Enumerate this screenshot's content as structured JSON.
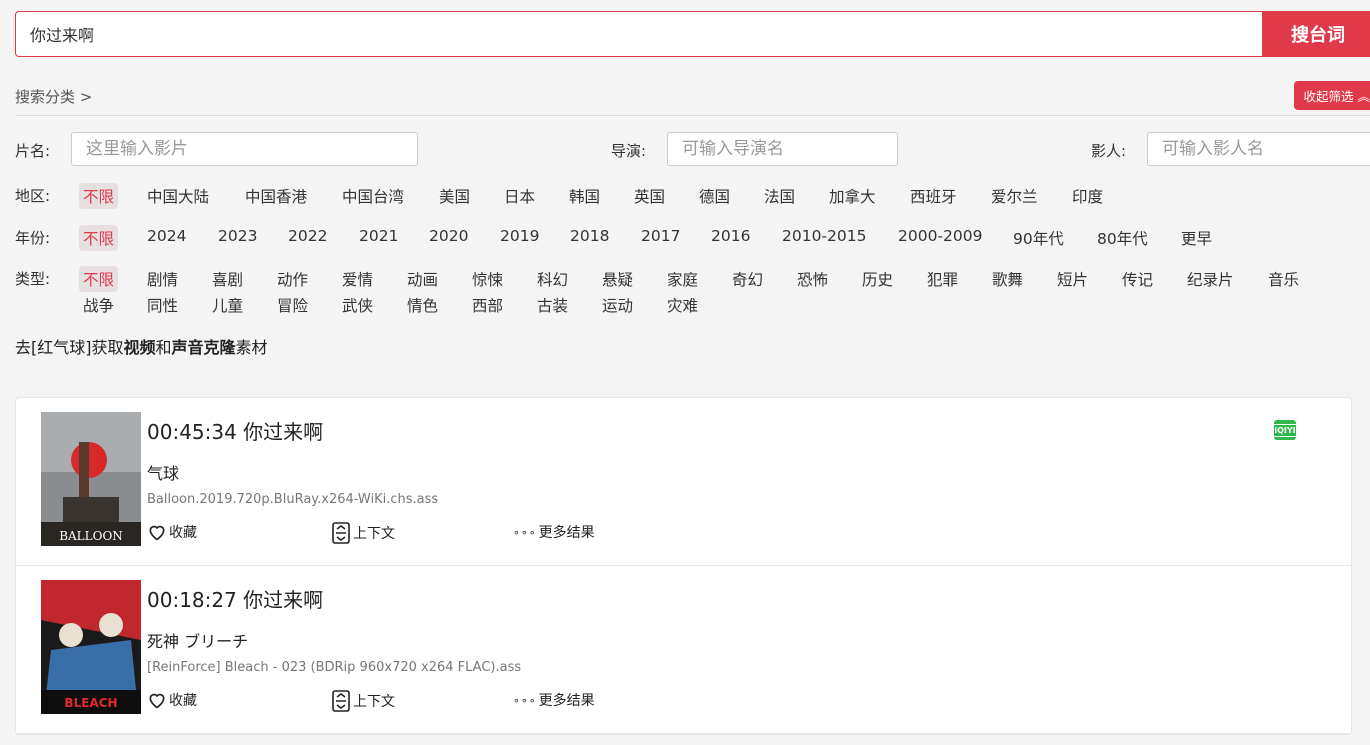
{
  "search": {
    "value": "你过来啊",
    "button": "搜台词"
  },
  "category": {
    "label": "搜索分类 >",
    "collapse": "收起筛选"
  },
  "fields": {
    "title": {
      "label": "片名:",
      "placeholder": "这里输入影片"
    },
    "director": {
      "label": "导演:",
      "placeholder": "可输入导演名"
    },
    "actor": {
      "label": "影人:",
      "placeholder": "可输入影人名"
    }
  },
  "filters": {
    "region": {
      "label": "地区:",
      "options": [
        "不限",
        "中国大陆",
        "中国香港",
        "中国台湾",
        "美国",
        "日本",
        "韩国",
        "英国",
        "德国",
        "法国",
        "加拿大",
        "西班牙",
        "爱尔兰",
        "印度"
      ]
    },
    "year": {
      "label": "年份:",
      "options": [
        "不限",
        "2024",
        "2023",
        "2022",
        "2021",
        "2020",
        "2019",
        "2018",
        "2017",
        "2016",
        "2010-2015",
        "2000-2009",
        "90年代",
        "80年代",
        "更早"
      ]
    },
    "genre": {
      "label": "类型:",
      "options": [
        "不限",
        "剧情",
        "喜剧",
        "动作",
        "爱情",
        "动画",
        "惊悚",
        "科幻",
        "悬疑",
        "家庭",
        "奇幻",
        "恐怖",
        "历史",
        "犯罪",
        "歌舞",
        "短片",
        "传记",
        "纪录片",
        "音乐",
        "战争",
        "同性",
        "儿童",
        "冒险",
        "武侠",
        "情色",
        "西部",
        "古装",
        "运动",
        "灾难"
      ]
    }
  },
  "promo": {
    "pre": "去[红气球]获取",
    "b1": "视频",
    "mid": "和",
    "b2": "声音克隆",
    "post": "素材"
  },
  "results": [
    {
      "time": "00:45:34 你过来啊",
      "title": "气球",
      "file": "Balloon.2019.720p.BluRay.x264-WiKi.chs.ass",
      "fav": "收藏",
      "context": "上下文",
      "more": "更多结果",
      "poster_text": "BALLOON",
      "platform": "iQIYI"
    },
    {
      "time": "00:18:27 你过来啊",
      "title": "死神 ブリーチ",
      "file": "[ReinForce] Bleach - 023 (BDRip 960x720 x264 FLAC).ass",
      "fav": "收藏",
      "context": "上下文",
      "more": "更多结果",
      "poster_text": "BLEACH"
    }
  ],
  "colors": {
    "accent": "#e0394a",
    "iqiyi": "#2fb84c"
  }
}
